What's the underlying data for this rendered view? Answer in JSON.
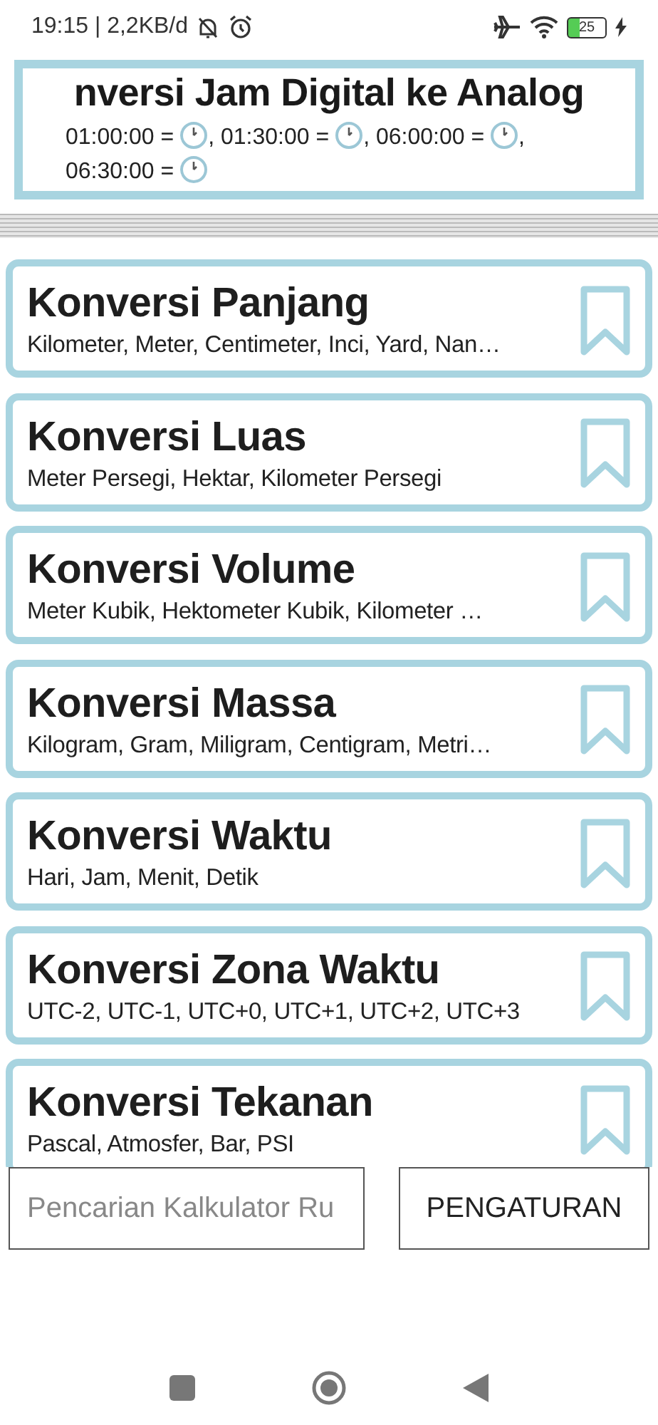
{
  "status_bar": {
    "time_info": "19:15 | 2,2KB/d",
    "battery": "25"
  },
  "header": {
    "title": "nversi Jam Digital ke Analog",
    "examples": [
      {
        "label": "01:00:00 =",
        "suffix": ","
      },
      {
        "label": "01:30:00 =",
        "suffix": ","
      },
      {
        "label": "06:00:00 =",
        "suffix": ","
      },
      {
        "label": "06:30:00 ="
      }
    ]
  },
  "cards": [
    {
      "title": "Konversi Panjang",
      "subtitle": "Kilometer, Meter, Centimeter, Inci, Yard, Nan…"
    },
    {
      "title": "Konversi Luas",
      "subtitle": "Meter Persegi, Hektar, Kilometer Persegi"
    },
    {
      "title": "Konversi Volume",
      "subtitle": "Meter Kubik, Hektometer Kubik, Kilometer …"
    },
    {
      "title": "Konversi Massa",
      "subtitle": "Kilogram, Gram, Miligram, Centigram, Metri…"
    },
    {
      "title": "Konversi Waktu",
      "subtitle": "Hari, Jam, Menit, Detik"
    },
    {
      "title": "Konversi Zona Waktu",
      "subtitle": "UTC-2, UTC-1, UTC+0, UTC+1, UTC+2, UTC+3"
    },
    {
      "title": "Konversi Tekanan",
      "subtitle": "Pascal, Atmosfer, Bar, PSI"
    }
  ],
  "search": {
    "placeholder": "Pencarian Kalkulator Ru"
  },
  "settings_button": "PENGATURAN"
}
